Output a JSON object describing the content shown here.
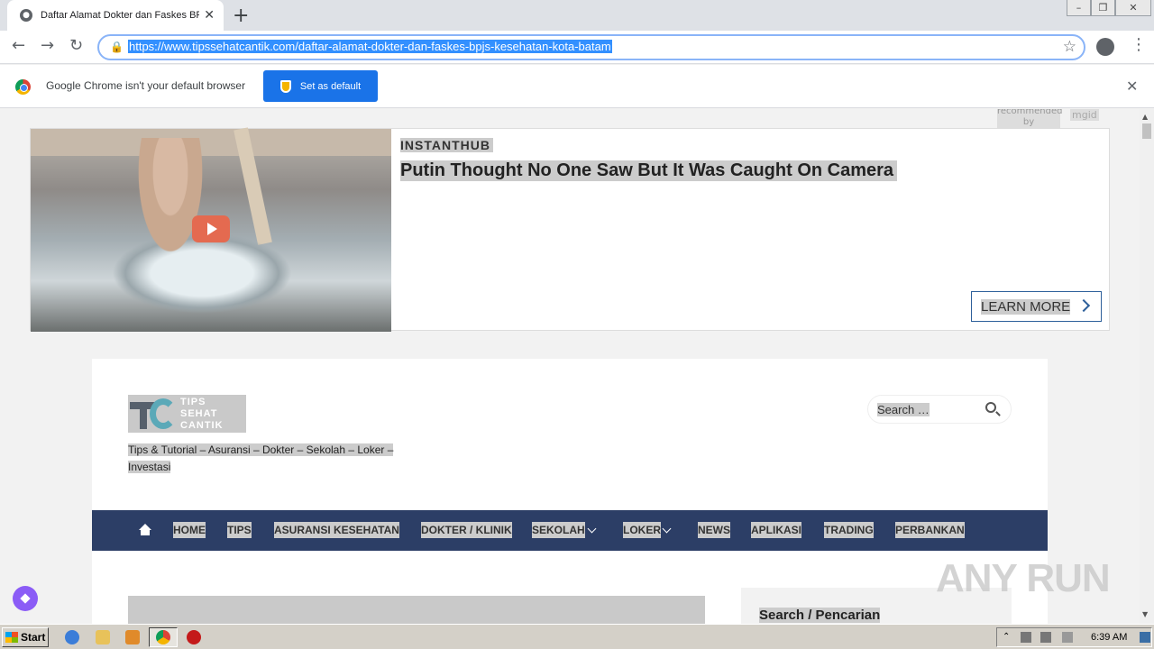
{
  "browser": {
    "tab_title": "Daftar Alamat Dokter dan Faskes BPJS",
    "url": "https://www.tipssehatcantik.com/daftar-alamat-dokter-dan-faskes-bpjs-kesehatan-kota-batam"
  },
  "infobar": {
    "message": "Google Chrome isn't your default browser",
    "button": "Set as default"
  },
  "ad": {
    "recommended": "recommended by",
    "brand": "mgid",
    "source": "INSTANTHUB",
    "title": "Putin Thought No One Saw But It Was Caught On Camera",
    "cta": "LEARN MORE"
  },
  "site": {
    "logo_lines": [
      "TIPS",
      "SEHAT",
      "CANTIK"
    ],
    "tagline": "Tips & Tutorial – Asuransi – Dokter – Sekolah – Loker – Investasi",
    "search_placeholder": "Search …",
    "nav": [
      "HOME",
      "TIPS",
      "ASURANSI KESEHATAN",
      "DOKTER / KLINIK",
      "SEKOLAH",
      "LOKER",
      "NEWS",
      "APLIKASI",
      "TRADING",
      "PERBANKAN"
    ],
    "sidebar_title": "Search / Pencarian"
  },
  "watermark": "ANY RUN",
  "taskbar": {
    "start": "Start",
    "time": "6:39 AM"
  },
  "colors": {
    "nav_bg": "#2c3e66",
    "chrome_accent": "#1a73e8",
    "url_highlight": "#3390ff"
  }
}
